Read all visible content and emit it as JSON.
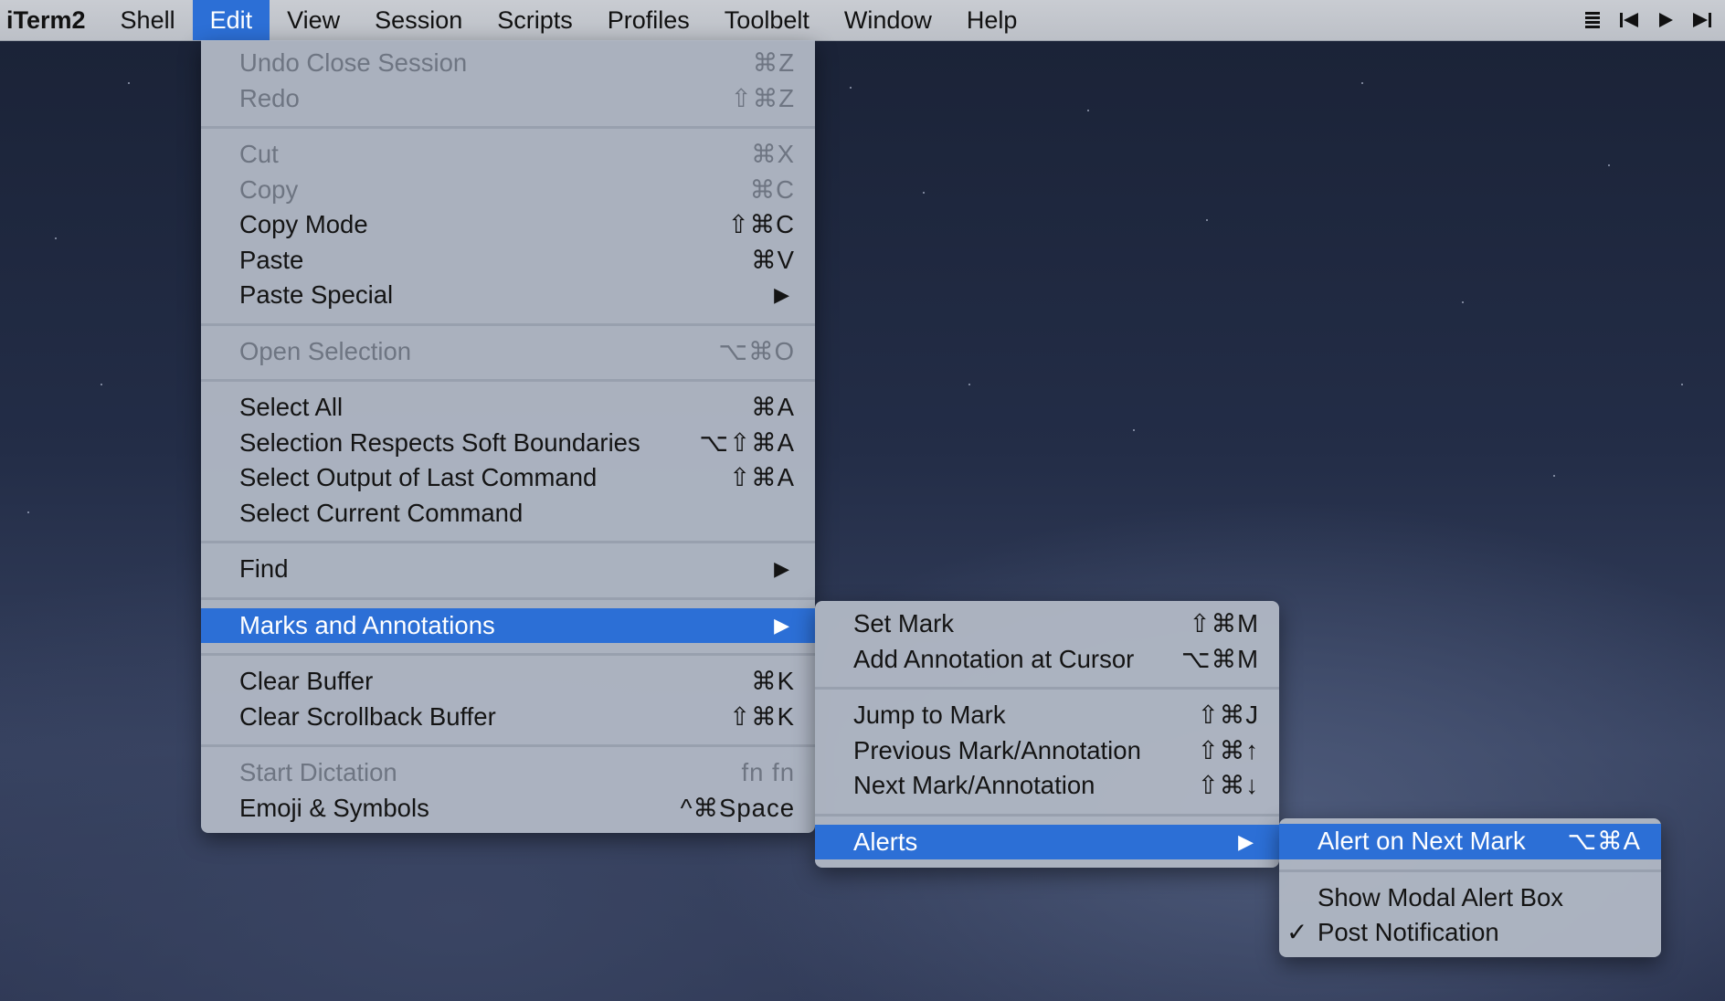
{
  "menubar": {
    "app": "iTerm2",
    "items": [
      "Shell",
      "Edit",
      "View",
      "Session",
      "Scripts",
      "Profiles",
      "Toolbelt",
      "Window",
      "Help"
    ],
    "active": "Edit",
    "right_icons": [
      "list-icon",
      "skip-back-icon",
      "play-icon",
      "skip-forward-icon"
    ]
  },
  "edit_menu": {
    "undo_close_session": {
      "label": "Undo Close Session",
      "shortcut": "⌘Z"
    },
    "redo": {
      "label": "Redo",
      "shortcut": "⇧⌘Z"
    },
    "cut": {
      "label": "Cut",
      "shortcut": "⌘X"
    },
    "copy": {
      "label": "Copy",
      "shortcut": "⌘C"
    },
    "copy_mode": {
      "label": "Copy Mode",
      "shortcut": "⇧⌘C"
    },
    "paste": {
      "label": "Paste",
      "shortcut": "⌘V"
    },
    "paste_special": {
      "label": "Paste Special"
    },
    "open_selection": {
      "label": "Open Selection",
      "shortcut": "⌥⌘O"
    },
    "select_all": {
      "label": "Select All",
      "shortcut": "⌘A"
    },
    "selection_respects": {
      "label": "Selection Respects Soft Boundaries",
      "shortcut": "⌥⇧⌘A"
    },
    "select_output": {
      "label": "Select Output of Last Command",
      "shortcut": "⇧⌘A"
    },
    "select_current": {
      "label": "Select Current Command"
    },
    "find": {
      "label": "Find"
    },
    "marks_annotations": {
      "label": "Marks and Annotations"
    },
    "clear_buffer": {
      "label": "Clear Buffer",
      "shortcut": "⌘K"
    },
    "clear_scrollback": {
      "label": "Clear Scrollback Buffer",
      "shortcut": "⇧⌘K"
    },
    "start_dictation": {
      "label": "Start Dictation",
      "shortcut": "fn fn"
    },
    "emoji_symbols": {
      "label": "Emoji & Symbols",
      "shortcut": "^⌘Space"
    }
  },
  "marks_menu": {
    "set_mark": {
      "label": "Set Mark",
      "shortcut": "⇧⌘M"
    },
    "add_annotation": {
      "label": "Add Annotation at Cursor",
      "shortcut": "⌥⌘M"
    },
    "jump_to_mark": {
      "label": "Jump to Mark",
      "shortcut": "⇧⌘J"
    },
    "previous_mark": {
      "label": "Previous Mark/Annotation",
      "shortcut": "⇧⌘↑"
    },
    "next_mark": {
      "label": "Next Mark/Annotation",
      "shortcut": "⇧⌘↓"
    },
    "alerts": {
      "label": "Alerts"
    }
  },
  "alerts_menu": {
    "alert_next_mark": {
      "label": "Alert on Next Mark",
      "shortcut": "⌥⌘A"
    },
    "show_modal": {
      "label": "Show Modal Alert Box"
    },
    "post_notification": {
      "label": "Post Notification",
      "checked": "✓"
    }
  },
  "colors": {
    "highlight": "#2c6fd6",
    "menu_bg": "#b0b7c4",
    "disabled_text": "#6e7582"
  }
}
